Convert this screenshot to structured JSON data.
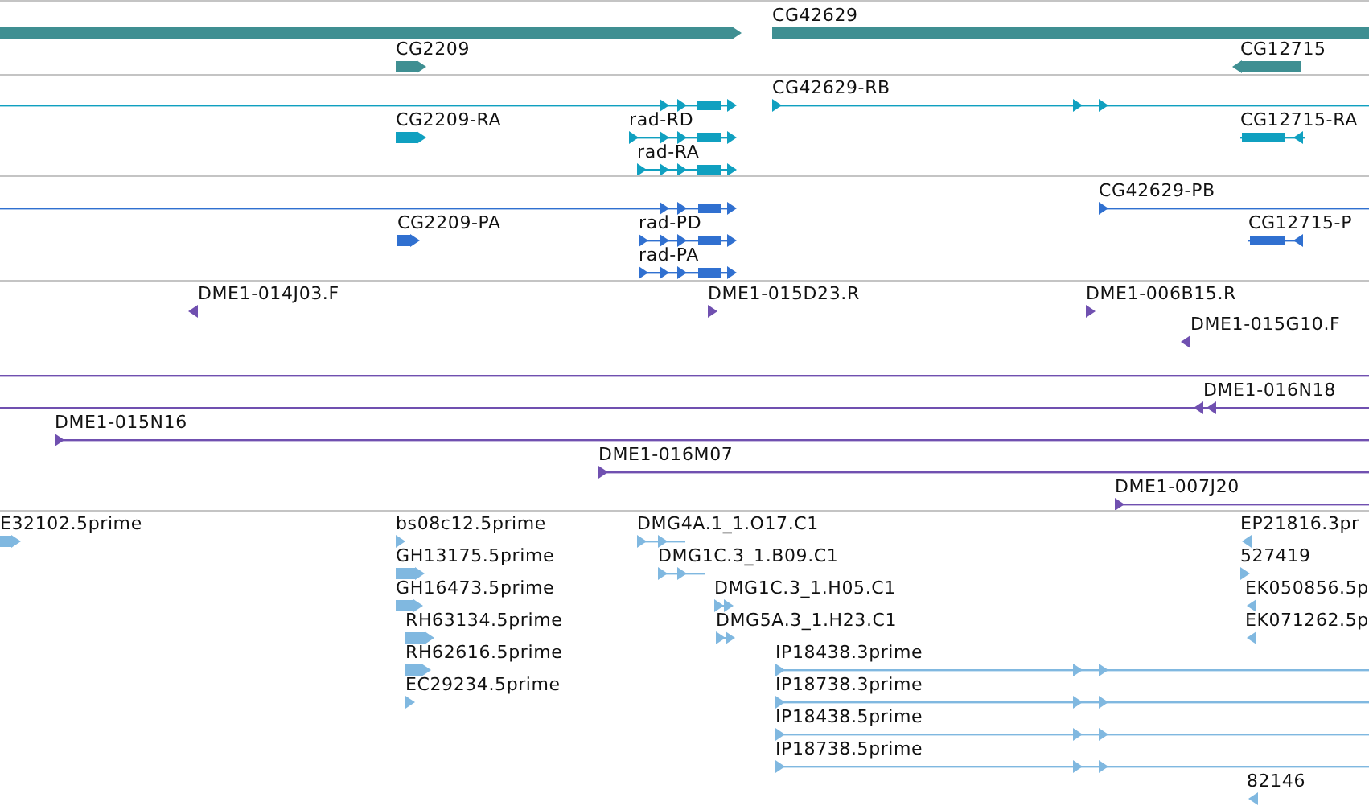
{
  "tracks": [
    {
      "color": "#3f8f92",
      "features": [
        {
          "kind": "bar",
          "reverse": false
        },
        {
          "label": "CG42629",
          "kind": "bar",
          "reverse": false
        },
        {
          "label": "CG2209",
          "kind": "bar",
          "reverse": false
        },
        {
          "label": "CG12715",
          "kind": "bar",
          "reverse": true
        }
      ]
    },
    {
      "color": "#10a0c0",
      "features": [
        {
          "kind": "line",
          "reverse": false
        },
        {
          "label": "CG42629-RB",
          "kind": "line",
          "reverse": false
        },
        {
          "label": "CG2209-RA",
          "kind": "bar",
          "reverse": false
        },
        {
          "label": "rad-RD",
          "kind": "line",
          "reverse": false
        },
        {
          "label": "rad-RA",
          "kind": "line",
          "reverse": false
        },
        {
          "label": "CG12715-RA",
          "kind": "line",
          "reverse": true
        }
      ]
    },
    {
      "color": "#3070d0",
      "features": [
        {
          "kind": "line",
          "reverse": false
        },
        {
          "label": "CG42629-PB",
          "kind": "line",
          "reverse": false
        },
        {
          "label": "CG2209-PA",
          "kind": "bar",
          "reverse": false
        },
        {
          "label": "rad-PD",
          "kind": "line",
          "reverse": false
        },
        {
          "label": "rad-PA",
          "kind": "line",
          "reverse": false
        },
        {
          "label": "CG12715-P",
          "kind": "line",
          "reverse": true
        }
      ]
    },
    {
      "color": "#7050b0",
      "features": [
        {
          "label": "DME1-014J03.F",
          "kind": "mark",
          "reverse": true
        },
        {
          "label": "DME1-015D23.R",
          "kind": "mark",
          "reverse": false
        },
        {
          "label": "DME1-006B15.R",
          "kind": "mark",
          "reverse": false
        },
        {
          "label": "DME1-015G10.F",
          "kind": "mark",
          "reverse": true
        },
        {
          "kind": "line"
        },
        {
          "label": "DME1-016N18",
          "kind": "line",
          "reverse": true
        },
        {
          "label": "DME1-015N16",
          "kind": "line",
          "reverse": false
        },
        {
          "label": "DME1-016M07",
          "kind": "line",
          "reverse": false
        },
        {
          "label": "DME1-007J20",
          "kind": "line",
          "reverse": false
        }
      ]
    },
    {
      "color": "#80b8e0",
      "features": [
        {
          "label": "E32102.5prime",
          "kind": "bar",
          "reverse": false
        },
        {
          "label": "bs08c12.5prime",
          "kind": "mark",
          "reverse": false
        },
        {
          "label": "GH13175.5prime",
          "kind": "bar",
          "reverse": false
        },
        {
          "label": "GH16473.5prime",
          "kind": "bar",
          "reverse": false
        },
        {
          "label": "RH63134.5prime",
          "kind": "bar",
          "reverse": false
        },
        {
          "label": "RH62616.5prime",
          "kind": "bar",
          "reverse": false
        },
        {
          "label": "EC29234.5prime",
          "kind": "mark",
          "reverse": false
        },
        {
          "label": "DMG4A.1_1.O17.C1",
          "kind": "line",
          "reverse": false
        },
        {
          "label": "DMG1C.3_1.B09.C1",
          "kind": "line",
          "reverse": false
        },
        {
          "label": "DMG1C.3_1.H05.C1",
          "kind": "line",
          "reverse": false
        },
        {
          "label": "DMG5A.3_1.H23.C1",
          "kind": "line",
          "reverse": false
        },
        {
          "label": "IP18438.3prime",
          "kind": "line",
          "reverse": false
        },
        {
          "label": "IP18738.3prime",
          "kind": "line",
          "reverse": false
        },
        {
          "label": "IP18438.5prime",
          "kind": "line",
          "reverse": false
        },
        {
          "label": "IP18738.5prime",
          "kind": "line",
          "reverse": false
        },
        {
          "label": "EP21816.3pr",
          "kind": "mark",
          "reverse": true
        },
        {
          "label": "527419",
          "kind": "mark",
          "reverse": false
        },
        {
          "label": "EK050856.5p",
          "kind": "mark",
          "reverse": true
        },
        {
          "label": "EK071262.5p",
          "kind": "mark",
          "reverse": true
        },
        {
          "label": "82146",
          "kind": "mark",
          "reverse": true
        }
      ]
    }
  ]
}
